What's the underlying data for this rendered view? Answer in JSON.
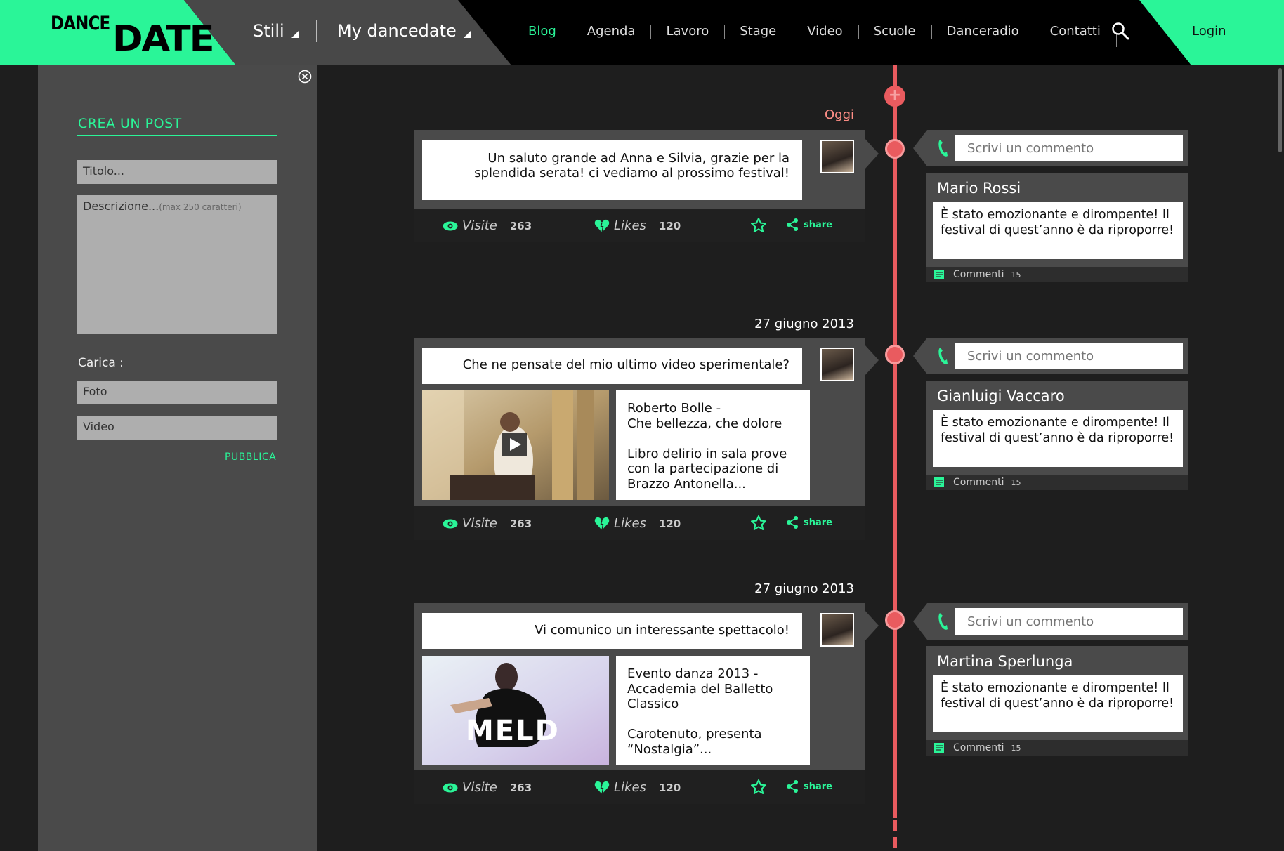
{
  "header": {
    "logo_part1": "DANCE",
    "logo_part2": "DATE",
    "dropdown_stili": "Stili",
    "dropdown_my": "My dancedate",
    "nav": [
      "Blog",
      "Agenda",
      "Lavoro",
      "Stage",
      "Video",
      "Scuole",
      "Danceradio",
      "Contatti"
    ],
    "login": "Login",
    "colors": {
      "accent": "#2af598",
      "timeline": "#e95b5f"
    }
  },
  "create_post": {
    "title": "CREA UN POST",
    "title_placeholder": "Titolo...",
    "description_placeholder": "Descrizione...",
    "description_hint": "(max 250 caratteri)",
    "upload_label": "Carica :",
    "photo": "Foto",
    "video": "Video",
    "publish": "PUBBLICA"
  },
  "posts": [
    {
      "date": "Oggi",
      "text": "Un saluto grande ad Anna e Silvia, grazie per la splendida serata! ci vediamo al prossimo festival!",
      "visits_label": "Visite",
      "visits": "263",
      "likes_label": "Likes",
      "likes": "120",
      "share": "share",
      "comment_placeholder": "Scrivi un commento",
      "comment": {
        "author": "Mario Rossi",
        "text": "È stato emozionante e dirompente! Il festival di quest’anno è da riproporre!",
        "count_label": "Commenti",
        "count": "15"
      }
    },
    {
      "date": "27 giugno 2013",
      "text": "Che ne pensate del mio ultimo video sperimentale?",
      "media_text": "Roberto Bolle -\nChe bellezza, che dolore\n\nLibro delirio in sala prove con la partecipazione di Brazzo Antonella...",
      "visits_label": "Visite",
      "visits": "263",
      "likes_label": "Likes",
      "likes": "120",
      "share": "share",
      "comment_placeholder": "Scrivi un commento",
      "comment": {
        "author": "Gianluigi Vaccaro",
        "text": "È stato emozionante e dirompente! Il festival di quest’anno è da riproporre!",
        "count_label": "Commenti",
        "count": "15"
      }
    },
    {
      "date": "27 giugno 2013",
      "text": "Vi comunico un interessante spettacolo!",
      "media_text": "Evento danza 2013 -\nAccademia del Balletto Classico\n\nCarotenuto, presenta “Nostalgia”...",
      "media_image_text": "MELD",
      "visits_label": "Visite",
      "visits": "263",
      "likes_label": "Likes",
      "likes": "120",
      "share": "share",
      "comment_placeholder": "Scrivi un commento",
      "comment": {
        "author": "Martina Sperlunga",
        "text": "È stato emozionante e dirompente! Il festival di quest’anno è da riproporre!",
        "count_label": "Commenti",
        "count": "15"
      }
    }
  ]
}
